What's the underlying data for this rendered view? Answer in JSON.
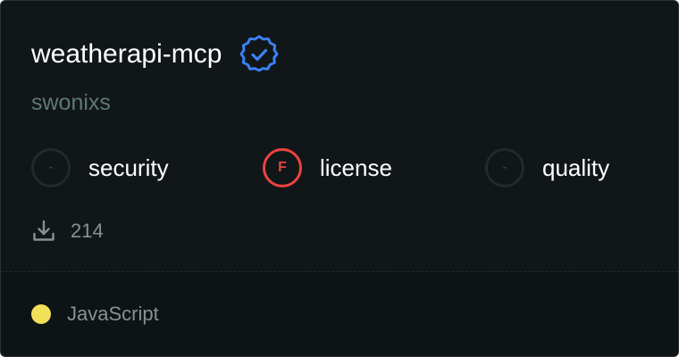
{
  "package": {
    "name": "weatherapi-mcp",
    "owner": "swonixs",
    "verified_icon": "verified-badge-icon",
    "downloads": "214",
    "download_icon": "download-icon"
  },
  "scores": [
    {
      "label": "security",
      "grade": "-"
    },
    {
      "label": "license",
      "grade": "F"
    },
    {
      "label": "quality",
      "grade": "-"
    }
  ],
  "language": {
    "name": "JavaScript",
    "color": "#f1e05a"
  },
  "colors": {
    "verified": "#3b82f6",
    "grade_fail": "#ea4343",
    "owner": "#5c7a6f"
  }
}
